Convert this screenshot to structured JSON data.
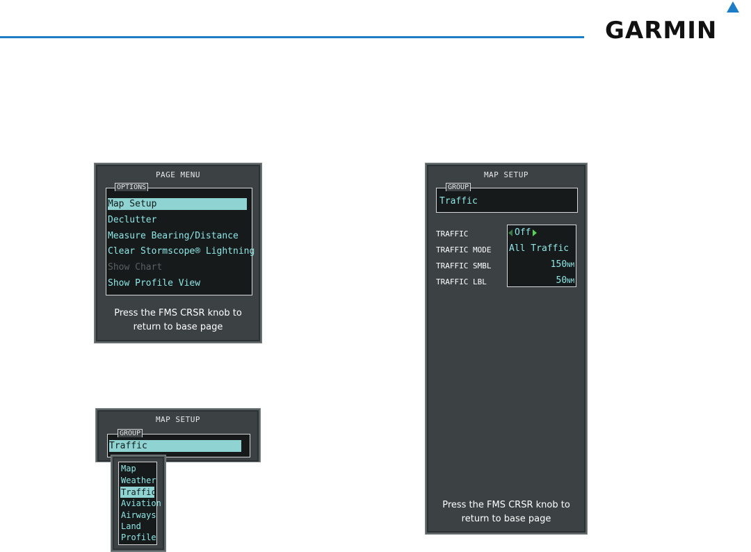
{
  "brand": {
    "logo_text": "GARMIN"
  },
  "page_menu": {
    "title": "PAGE MENU",
    "group_label": "OPTIONS",
    "items": [
      "Map Setup",
      "Declutter",
      "Measure Bearing/Distance",
      "Clear Stormscope® Lightning",
      "Show Chart",
      "Show Profile View"
    ],
    "selected_index": 0,
    "disabled_index": 4,
    "note_line1": "Press the FMS CRSR knob to",
    "note_line2": "return to base page"
  },
  "group_popup": {
    "title": "MAP SETUP",
    "group_label": "GROUP",
    "selected_value": "Traffic",
    "options": [
      "Map",
      "Weather",
      "Traffic",
      "Aviation",
      "Airways",
      "Land",
      "Profile"
    ],
    "selected_index": 2
  },
  "map_setup": {
    "title": "MAP SETUP",
    "group_label": "GROUP",
    "group_value": "Traffic",
    "rows": [
      {
        "label": "TRAFFIC",
        "value": "Off",
        "unit": ""
      },
      {
        "label": "TRAFFIC MODE",
        "value": "All Traffic",
        "unit": ""
      },
      {
        "label": "TRAFFIC SMBL",
        "value": "150",
        "unit": "NM"
      },
      {
        "label": "TRAFFIC LBL",
        "value": "50",
        "unit": "NM"
      }
    ],
    "note_line1": "Press the FMS CRSR knob to",
    "note_line2": "return to base page"
  },
  "colors": {
    "accent": "#1d7cc6",
    "cyan_text": "#8fe6e6",
    "panel": "#3c4244"
  }
}
